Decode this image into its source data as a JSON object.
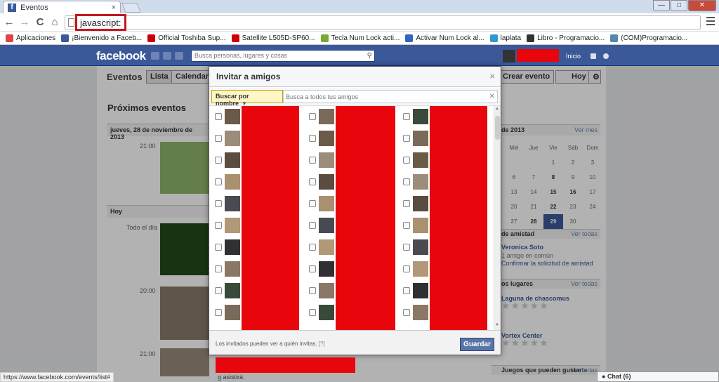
{
  "browser": {
    "tab_title": "Eventos",
    "tab_close": "×",
    "url": "javascript:",
    "window_controls": [
      "—",
      "□",
      "✕"
    ],
    "nav": {
      "back": "←",
      "forward": "→",
      "reload": "C",
      "home": "⌂"
    },
    "bookmarks": [
      {
        "label": "Aplicaciones",
        "icon": "apps-grid-icon",
        "color": "#d44"
      },
      {
        "label": "¡Bienvenido a Faceb...",
        "icon": "facebook-icon",
        "color": "#3b5998"
      },
      {
        "label": "Official Toshiba Sup...",
        "icon": "toshiba-icon",
        "color": "#c00"
      },
      {
        "label": "Satellite L505D-SP60...",
        "icon": "toshiba-icon",
        "color": "#c00"
      },
      {
        "label": "Tecla Num Lock acti...",
        "icon": "chat-bubble-icon",
        "color": "#7a3"
      },
      {
        "label": "Activar Num Lock al...",
        "icon": "tumblr-icon",
        "color": "#36b"
      },
      {
        "label": "laplata",
        "icon": "x-icon",
        "color": "#39c"
      },
      {
        "label": "Libro - Programacio...",
        "icon": "scribd-icon",
        "color": "#333"
      },
      {
        "label": "(COM)Programacio...",
        "icon": "globe-icon",
        "color": "#58a"
      }
    ],
    "status_url": "https://www.facebook.com/events/list#"
  },
  "fb": {
    "logo": "facebook",
    "search_placeholder": "Busca personas, lugares y cosas",
    "home": "Inicio"
  },
  "events_page": {
    "title": "Eventos",
    "tabs": [
      "Lista",
      "Calendario"
    ],
    "create_button": "Crear evento",
    "today_button": "Hoy",
    "upcoming": "Próximos eventos",
    "day1": "jueves, 28 de noviembre de 2013",
    "time1": "21:00",
    "today_header": "Hoy",
    "all_day": "Todo el día",
    "time2": "20:00",
    "time3": "21:00",
    "event_caption": "g asistirá."
  },
  "sidebar": {
    "calendar_title": "de 2013",
    "calendar_link": "Ver mes",
    "weekdays": [
      "Mié",
      "Jue",
      "Vie",
      "Sáb",
      "Dom"
    ],
    "weeks": [
      [
        "",
        "",
        "1",
        "2",
        "3"
      ],
      [
        "6",
        "7",
        "8",
        "9",
        "10"
      ],
      [
        "13",
        "14",
        "15",
        "16",
        "17"
      ],
      [
        "20",
        "21",
        "22",
        "23",
        "24"
      ],
      [
        "27",
        "28",
        "29",
        "30",
        ""
      ]
    ],
    "friend_req_title": "de amistad",
    "see_all": "Ver todas",
    "friend_name": "Veronica Soto",
    "mutual": "1 amigo en común",
    "confirm": "Confirmar la solicitud de amistad",
    "places_title": "os lugares",
    "place1": "Laguna de chascomus",
    "place2": "Vortex Center",
    "games_title": "Juegos que pueden gustarte",
    "stars": "★★★★★"
  },
  "dialog": {
    "title": "Invitar a amigos",
    "close": "×",
    "filter_label": "Buscar por nombre",
    "filter_caret": "▼",
    "search_placeholder": "Busca a todos tus amigos",
    "footer_note": "Los invitados pueden ver a quién invitas.",
    "footer_help": "[?]",
    "save": "Guardar"
  },
  "chat": "Chat (6)",
  "colors": {
    "fb_blue": "#3b5998",
    "redaction": "#e8060c",
    "highlight": "#c4161c"
  }
}
